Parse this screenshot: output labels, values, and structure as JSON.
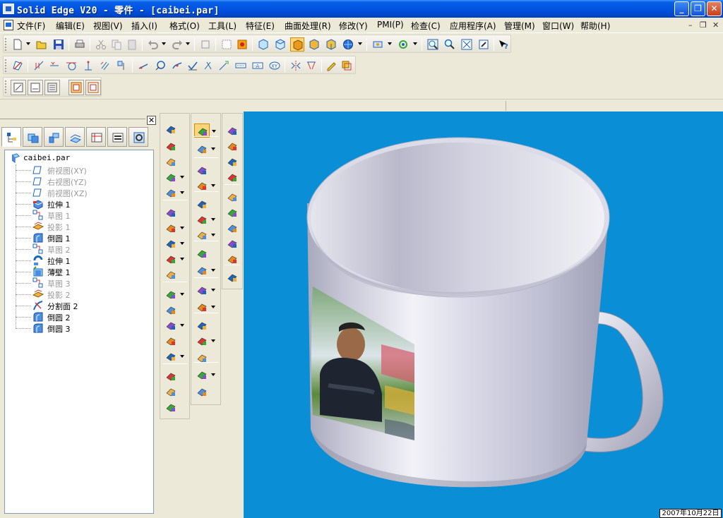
{
  "window": {
    "title": "Solid Edge V20 - 零件 - [caibei.par]",
    "buttons": {
      "minimize": "_",
      "maximize": "❐",
      "close": "✕"
    }
  },
  "menu": {
    "items": [
      "文件(F)",
      "编辑(E)",
      "视图(V)",
      "插入(I)",
      "格式(O)",
      "工具(L)",
      "特征(E)",
      "曲面处理(R)",
      "修改(Y)",
      "PMI(P)",
      "检查(C)",
      "应用程序(A)",
      "管理(M)",
      "窗口(W)",
      "帮助(H)"
    ],
    "mdi_buttons": [
      "–",
      "❐",
      "✕"
    ]
  },
  "panel": {
    "close_label": "✕",
    "tree": {
      "root": "caibei.par",
      "items": [
        {
          "label": "俯视图(XY)",
          "icon": "plane-icon",
          "dim": true
        },
        {
          "label": "右视图(YZ)",
          "icon": "plane-icon",
          "dim": true
        },
        {
          "label": "前视图(XZ)",
          "icon": "plane-icon",
          "dim": true
        },
        {
          "label": "拉伸 1",
          "icon": "extrude-icon",
          "dim": false
        },
        {
          "label": "草图 1",
          "icon": "sketch-icon",
          "dim": true
        },
        {
          "label": "投影 1",
          "icon": "project-icon",
          "dim": true
        },
        {
          "label": "倒圆 1",
          "icon": "round-icon",
          "dim": false
        },
        {
          "label": "草图 2",
          "icon": "sketch-icon",
          "dim": true
        },
        {
          "label": "拉伸 1",
          "icon": "revolve-icon",
          "dim": false
        },
        {
          "label": "薄壁 1",
          "icon": "thinwall-icon",
          "dim": false
        },
        {
          "label": "草图 3",
          "icon": "sketch-icon",
          "dim": true
        },
        {
          "label": "投影 2",
          "icon": "project-icon",
          "dim": true
        },
        {
          "label": "分割面 2",
          "icon": "split-face-icon",
          "dim": false
        },
        {
          "label": "倒圆 2",
          "icon": "round-icon",
          "dim": false
        },
        {
          "label": "倒圆 3",
          "icon": "round-icon",
          "dim": false
        }
      ]
    }
  },
  "status": {
    "date": "2007年10月22日"
  },
  "colors": {
    "viewport_bg": "#0a8ed6",
    "title_bar": "#0054e3",
    "mug_body": "#d9d9e6"
  }
}
